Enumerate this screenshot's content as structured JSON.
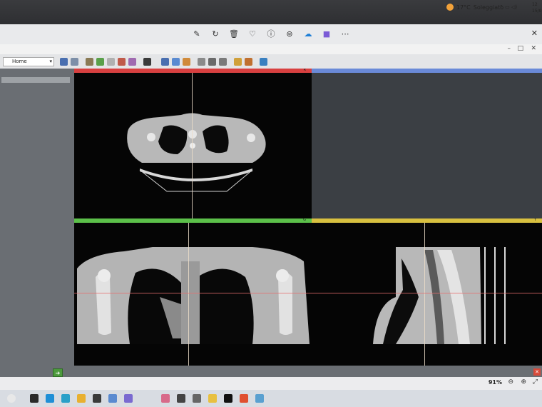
{
  "photo_viewer": {
    "toolbar_icons": [
      "edit-icon",
      "rotate-icon",
      "delete-icon",
      "heart-icon",
      "info-icon",
      "search-icon",
      "cloud-icon",
      "app-icon",
      "more-icon"
    ],
    "zoom_level": "91%"
  },
  "app": {
    "module_selector": {
      "value": "Home"
    },
    "left_field": "",
    "views": {
      "red": {
        "label": "R",
        "color": "#d84040"
      },
      "three_d": {
        "color": "#6a8ad8"
      },
      "green": {
        "label": "G",
        "color": "#5cc04a"
      },
      "yellow": {
        "label": "Y",
        "color": "#d8c040"
      }
    }
  },
  "taskbar": {
    "weather": {
      "temp": "17°C",
      "condition": "Soleggiato"
    },
    "clock": {
      "time": "12",
      "date": "15/0"
    }
  }
}
